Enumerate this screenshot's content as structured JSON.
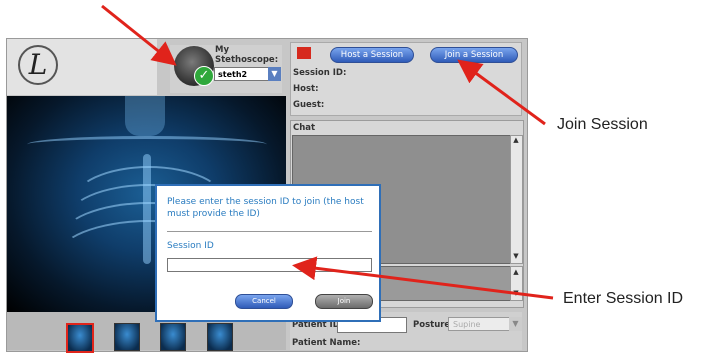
{
  "logo": {
    "glyph": "L"
  },
  "stethoscope": {
    "label": "My Stethoscope:",
    "selected": "steth2",
    "check_glyph": "✓",
    "arrow_glyph": "▼"
  },
  "session": {
    "host_button": "Host a Session",
    "join_button": "Join a Session",
    "session_id_label": "Session ID:",
    "host_label": "Host:",
    "guest_label": "Guest:"
  },
  "chat": {
    "label": "Chat",
    "scroll_up": "▲",
    "scroll_down": "▼"
  },
  "patient": {
    "id_label": "Patient ID:",
    "posture_label": "Posture:",
    "posture_value": "Supine",
    "posture_arrow": "▼",
    "name_label": "Patient Name:"
  },
  "dialog": {
    "message": "Please enter the session ID to join (the host must provide the ID)",
    "field_label": "Session ID",
    "cancel": "Cancel",
    "join": "Join"
  },
  "annotations": {
    "join_session": "Join Session",
    "enter_session_id": "Enter Session ID"
  },
  "colors": {
    "arrow": "#e0231b",
    "dialog_text": "#2a7cc0",
    "button_blue": "#2f5bb8"
  }
}
